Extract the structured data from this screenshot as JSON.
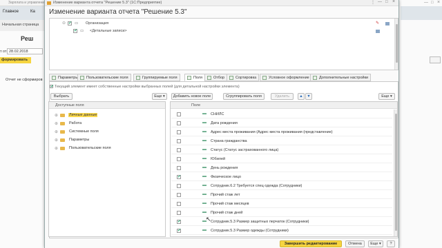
{
  "background_app": {
    "window_title": "Зарплата и управление...",
    "tabs": [
      "Главное",
      "Ка"
    ],
    "start_page": "Начальная страница",
    "header_label": "Реш",
    "date_label": "т от",
    "date_value": "28.02.2018",
    "form_button": "формировать",
    "message": "Отчет не сформиров"
  },
  "dialog": {
    "window_title": "Изменение варианта отчета \"Решение 5.3\" (1С:Предприятие)",
    "title": "Изменение варианта отчета \"Решение 5.3\"",
    "structure_rows": [
      {
        "label": "Организация",
        "checked": true
      },
      {
        "label": "<Детальные записи>",
        "checked": true
      }
    ],
    "tabs": [
      {
        "label": "Параметры",
        "active": false
      },
      {
        "label": "Пользовательские поля",
        "active": false
      },
      {
        "label": "Группируемые поля",
        "active": false
      },
      {
        "label": "Поля",
        "active": true
      },
      {
        "label": "Отбор",
        "active": false
      },
      {
        "label": "Сортировка",
        "active": false
      },
      {
        "label": "Условное оформление",
        "active": false
      },
      {
        "label": "Дополнительные настройки",
        "active": false
      }
    ],
    "hint": "Текущий элемент имеет собственные настройки выбранных полей (для детальной настройки элемента)",
    "toolbar": {
      "select": "Выбрать",
      "more_left": "Еще",
      "add_field": "Добавить новое поле",
      "group_fields": "Сгруппировать поля",
      "delete": "Удалить",
      "more_right": "Еще"
    },
    "available_fields": {
      "header": "Доступные поля",
      "items": [
        "Личные данные",
        "Работа",
        "Системные поля",
        "Параметры",
        "Пользовательские поля"
      ]
    },
    "selected_fields": {
      "header": "Поле",
      "items": [
        {
          "label": "СНИЛС",
          "checked": false
        },
        {
          "label": "Дата рождения",
          "checked": false
        },
        {
          "label": "Адрес места проживания (Адрес места проживания (представление)",
          "checked": false
        },
        {
          "label": "Страна гражданства",
          "checked": false
        },
        {
          "label": "Статус (Статус застрахованного лица)",
          "checked": false
        },
        {
          "label": "Юбилей",
          "checked": false
        },
        {
          "label": "День рождения",
          "checked": false
        },
        {
          "label": "Физическое лицо",
          "checked": true
        },
        {
          "label": "Сотрудник.6.2 Требуется спец одежда  (Сотрудники)",
          "checked": false
        },
        {
          "label": "Прочий стаж лет",
          "checked": false
        },
        {
          "label": "Прочий стаж месяцев",
          "checked": false
        },
        {
          "label": "Прочий стаж дней",
          "checked": false
        },
        {
          "label": "Сотрудник.5.3 Размер защитных перчаток (Сотрудники)",
          "checked": true
        },
        {
          "label": "Сотрудник.5.3 Размер одежды (Сотрудники)",
          "checked": true
        }
      ]
    },
    "footer": {
      "finish": "Завершить редактирование",
      "cancel": "Отмена",
      "more": "Еще",
      "help": "?"
    }
  }
}
